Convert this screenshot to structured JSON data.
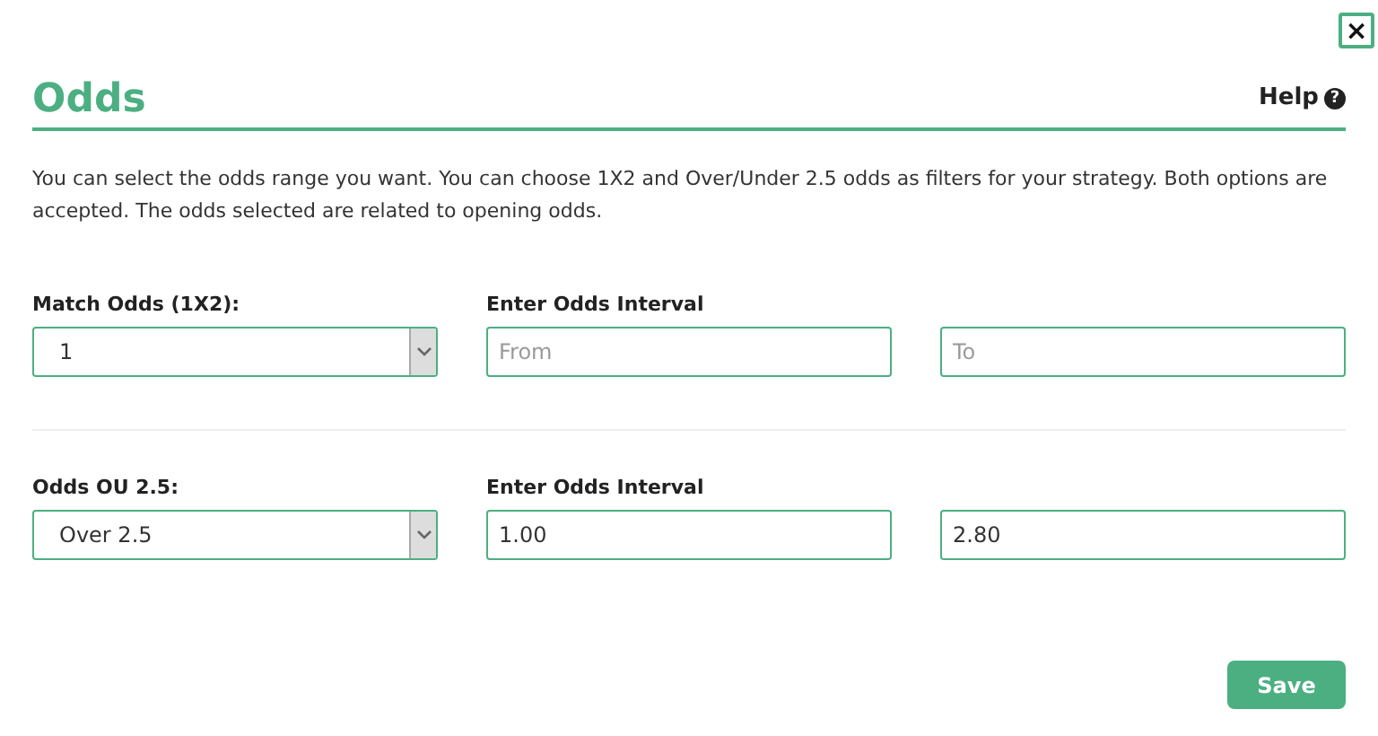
{
  "close_button": "×",
  "title": "Odds",
  "help": {
    "label": "Help",
    "icon": "?"
  },
  "description": "You can select the odds range you want. You can choose 1X2 and Over/Under 2.5 odds as filters for your strategy. Both options are accepted. The odds selected are related to opening odds.",
  "filters": [
    {
      "label": "Match Odds (1X2):",
      "select_value": "1",
      "interval_label": "Enter Odds Interval",
      "from": {
        "placeholder": "From"
      },
      "to": {
        "placeholder": "To"
      }
    },
    {
      "label": "Odds OU 2.5:",
      "select_value": "Over 2.5",
      "interval_label": "Enter Odds Interval",
      "from": {
        "value": "1.00"
      },
      "to": {
        "value": "2.80"
      }
    }
  ],
  "save_button": "Save"
}
